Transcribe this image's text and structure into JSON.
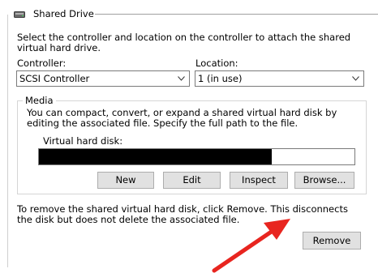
{
  "section": {
    "title": "Shared Drive",
    "intro": "Select the controller and location on the controller to attach the shared virtual hard drive."
  },
  "controller": {
    "label": "Controller:",
    "value": "SCSI Controller"
  },
  "location": {
    "label": "Location:",
    "value": "1 (in use)"
  },
  "media": {
    "title": "Media",
    "description": "You can compact, convert, or expand a shared virtual hard disk by editing the associated file. Specify the full path to the file.",
    "vhd_label": "Virtual hard disk:",
    "vhd_value": "",
    "buttons": {
      "new": "New",
      "edit": "Edit",
      "inspect": "Inspect",
      "browse": "Browse..."
    }
  },
  "remove": {
    "note": "To remove the shared virtual hard disk, click Remove. This disconnects the disk but does not delete the associated file.",
    "button": "Remove"
  },
  "annotation": {
    "arrow_color": "#e8251f"
  }
}
